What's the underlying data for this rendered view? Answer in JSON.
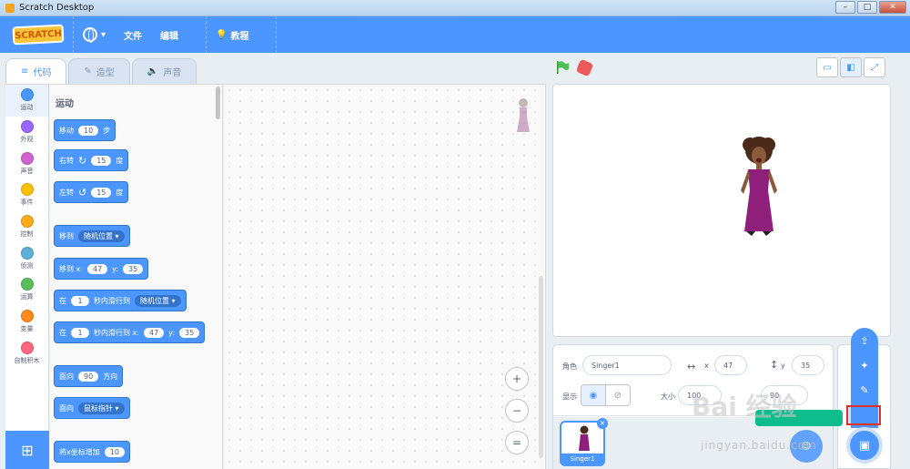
{
  "window": {
    "title": "Scratch Desktop"
  },
  "menu": {
    "logo": "SCRATCH",
    "file": "文件",
    "edit": "编辑",
    "tutorial": "教程"
  },
  "tabs": [
    {
      "label": "代码"
    },
    {
      "label": "造型"
    },
    {
      "label": "声音"
    }
  ],
  "categories": [
    {
      "label": "运动",
      "color": "#4c97ff"
    },
    {
      "label": "外观",
      "color": "#9966ff"
    },
    {
      "label": "声音",
      "color": "#cf63cf"
    },
    {
      "label": "事件",
      "color": "#ffbf00"
    },
    {
      "label": "控制",
      "color": "#ffab19"
    },
    {
      "label": "侦测",
      "color": "#5cb1d6"
    },
    {
      "label": "运算",
      "color": "#59c059"
    },
    {
      "label": "变量",
      "color": "#ff8c1a"
    },
    {
      "label": "自制积木",
      "color": "#ff6680"
    }
  ],
  "palette": {
    "section_title": "运动",
    "move": {
      "a": "移动",
      "n": "10",
      "b": "步"
    },
    "turn_right": {
      "a": "右转",
      "n": "15",
      "b": "度"
    },
    "turn_left": {
      "a": "左转",
      "n": "15",
      "b": "度"
    },
    "goto": {
      "a": "移到",
      "drop": "随机位置"
    },
    "goto_xy": {
      "a": "移到 x:",
      "x": "47",
      "yl": "y:",
      "y": "35"
    },
    "glide": {
      "a": "在",
      "n": "1",
      "b": "秒内滑行到",
      "drop": "随机位置"
    },
    "glide_xy": {
      "a": "在",
      "n": "1",
      "b": "秒内滑行到 x:",
      "x": "47",
      "yl": "y:",
      "y": "35"
    },
    "point_dir": {
      "a": "面向",
      "n": "90",
      "b": "方向"
    },
    "point_towards": {
      "a": "面向",
      "drop": "鼠标指针"
    },
    "change_x": {
      "a": "将x坐标增加",
      "n": "10"
    }
  },
  "zoom": {
    "in": "+",
    "out": "−",
    "reset": "="
  },
  "sprite_info": {
    "sprite_label": "角色",
    "sprite_name": "Singer1",
    "x_label": "x",
    "x": "47",
    "y_label": "y",
    "y": "35",
    "show_label": "显示",
    "size_label": "大小",
    "size": "100",
    "direction": "90"
  },
  "sprites": [
    {
      "name": "Singer1"
    }
  ],
  "watermark": {
    "main": "Bai 经验",
    "sub": "jingyan.baidu.com"
  }
}
